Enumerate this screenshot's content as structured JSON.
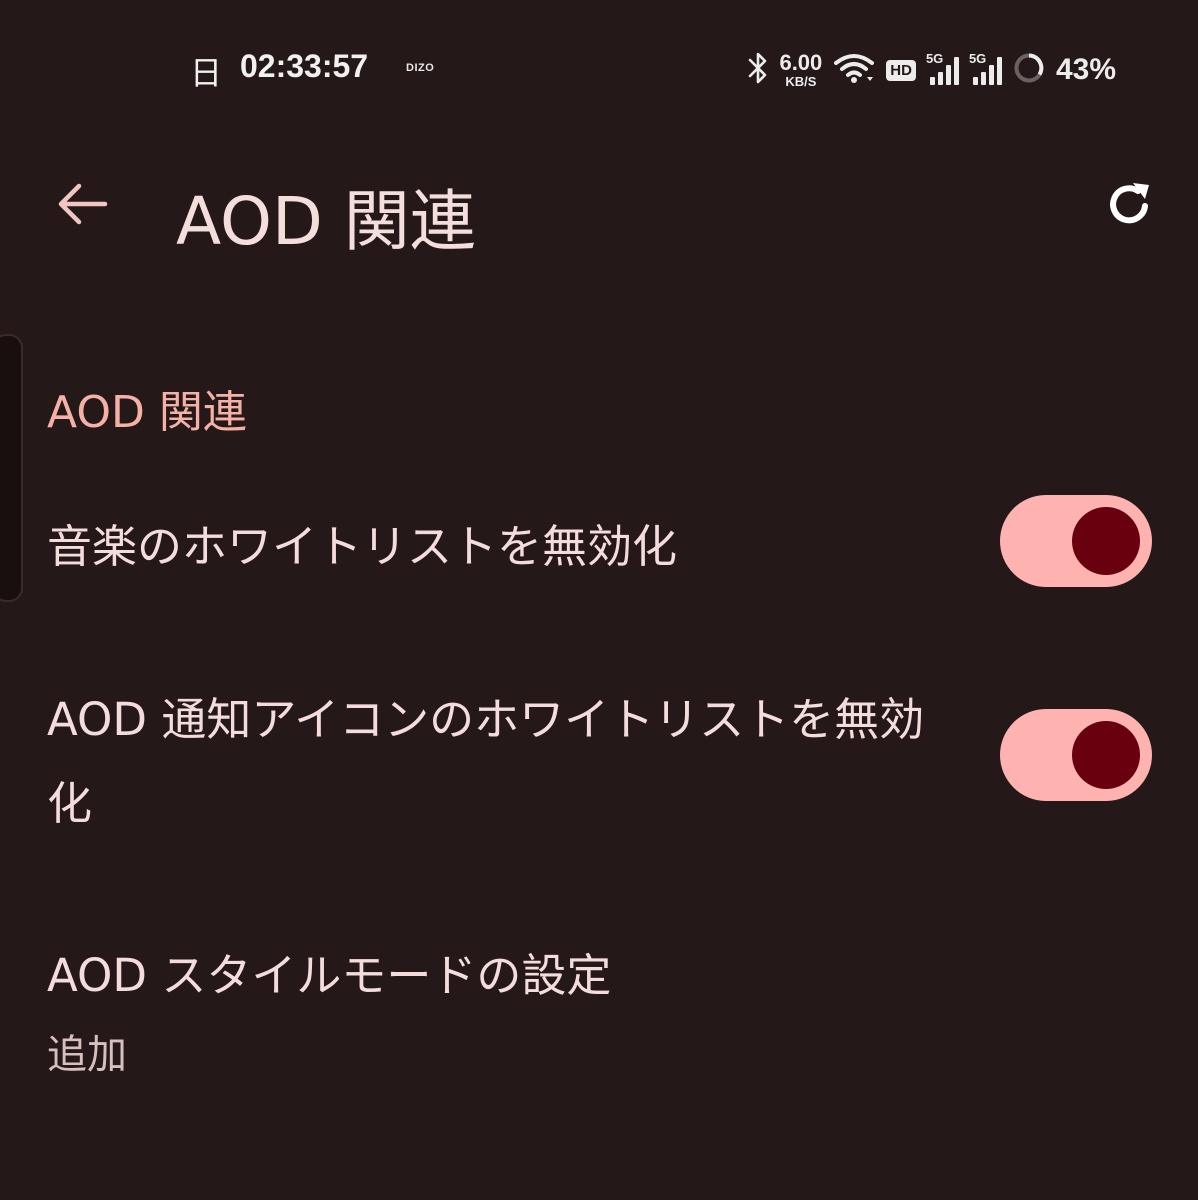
{
  "status_bar": {
    "day": "日",
    "time": "02:33:57",
    "carrier": "DIZO",
    "net_speed_value": "6.00",
    "net_speed_unit": "KB/S",
    "hd_badge": "HD",
    "sim1_label": "5G",
    "sim2_label": "5G",
    "battery_percent": "43%"
  },
  "app_bar": {
    "title": "AOD 関連"
  },
  "section": {
    "header": "AOD 関連"
  },
  "preferences": [
    {
      "title": "音楽のホワイトリストを無効化",
      "enabled": true
    },
    {
      "title": "AOD 通知アイコンのホワイトリストを無効化",
      "enabled": true
    },
    {
      "title": "AOD スタイルモードの設定",
      "summary": "追加"
    }
  ],
  "colors": {
    "background": "#241819",
    "accent": "#f5b1a5",
    "toggle_track": "#ffb3b1",
    "toggle_knob": "#68000e"
  }
}
